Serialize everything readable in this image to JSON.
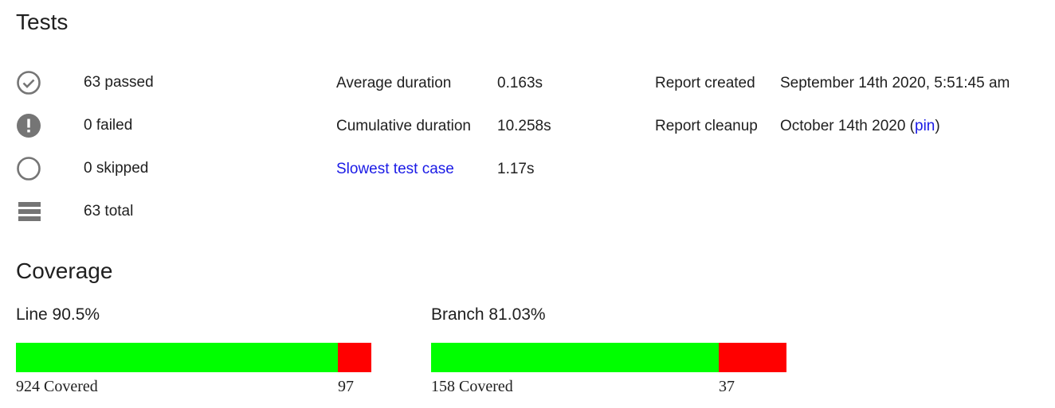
{
  "tests": {
    "heading": "Tests",
    "stats": [
      {
        "icon": "check-circle-icon",
        "text": "63 passed"
      },
      {
        "icon": "alert-circle-icon",
        "text": "0 failed"
      },
      {
        "icon": "empty-circle-icon",
        "text": "0 skipped"
      },
      {
        "icon": "list-icon",
        "text": "63 total"
      }
    ],
    "durations": {
      "average_label": "Average duration",
      "average_value": "0.163s",
      "cumulative_label": "Cumulative duration",
      "cumulative_value": "10.258s",
      "slowest_label": "Slowest test case",
      "slowest_value": "1.17s"
    },
    "report": {
      "created_label": "Report created",
      "created_value": "September 14th 2020, 5:51:45 am",
      "cleanup_label": "Report cleanup",
      "cleanup_value": "October 14th 2020",
      "cleanup_open": " (",
      "pin_link": "pin",
      "cleanup_close": ")"
    }
  },
  "coverage": {
    "heading": "Coverage",
    "line": {
      "title": "Line 90.5%",
      "covered": 924,
      "missed": 97,
      "covered_label": "924 Covered",
      "missed_label": "97"
    },
    "branch": {
      "title": "Branch 81.03%",
      "covered": 158,
      "missed": 37,
      "covered_label": "158 Covered",
      "missed_label": "37"
    },
    "colors": {
      "covered": "#00ff00",
      "missed": "#ff0000"
    }
  },
  "colors": {
    "link": "#1a1ae6",
    "icon": "#757575"
  }
}
